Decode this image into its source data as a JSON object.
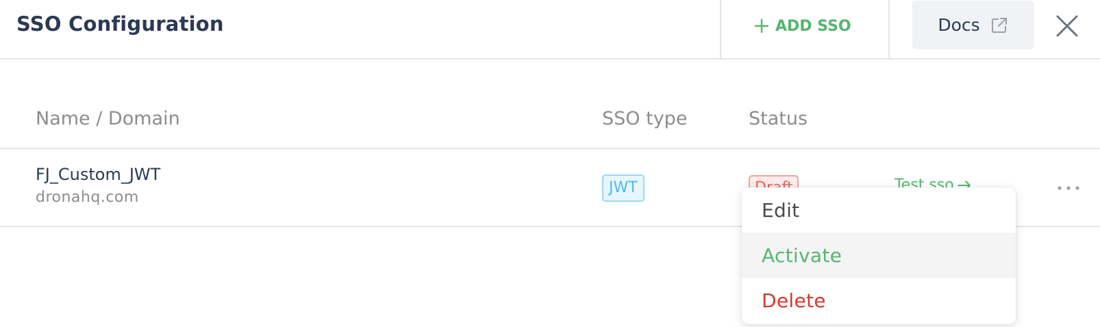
{
  "header": {
    "title": "SSO Configuration",
    "add_sso_label": "ADD SSO",
    "docs_label": "Docs",
    "icons": {
      "add": "plus-icon",
      "docs": "external-link-icon",
      "close": "close-icon"
    }
  },
  "table": {
    "columns": [
      "Name / Domain",
      "SSO type",
      "Status"
    ],
    "rows": [
      {
        "name": "FJ_Custom_JWT",
        "domain": "dronahq.com",
        "sso_type": "JWT",
        "status": "Draft",
        "test_link": "Test sso",
        "icons": {
          "test": "arrow-right-icon",
          "more": "more-horizontal-icon"
        }
      }
    ]
  },
  "menu": {
    "items": [
      {
        "label": "Edit"
      },
      {
        "label": "Activate"
      },
      {
        "label": "Delete"
      }
    ]
  },
  "colors": {
    "title": "#2b3a55",
    "green": "#53b66e",
    "danger": "#d9372c",
    "info": "#51b9e8",
    "muted": "#8c8c8c",
    "border": "#e3e5e8"
  }
}
